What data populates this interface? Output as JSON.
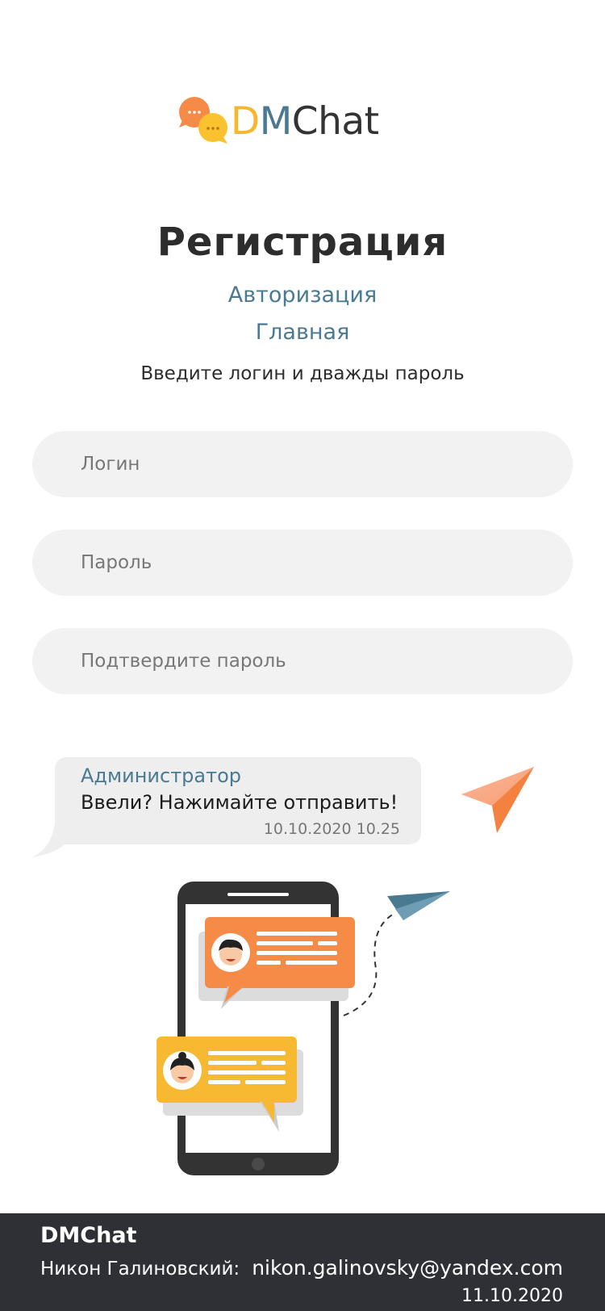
{
  "brand": {
    "d": "D",
    "m": "M",
    "rest": "Chat"
  },
  "page": {
    "title": "Регистрация",
    "auth_link": "Авторизация",
    "main_link": "Главная",
    "hint": "Введите логин и дважды пароль"
  },
  "form": {
    "login_placeholder": "Логин",
    "password_placeholder": "Пароль",
    "confirm_placeholder": "Подтвердите пароль"
  },
  "message": {
    "author": "Администратор",
    "text": "Ввели? Нажимайте отправить!",
    "time": "10.10.2020 10.25"
  },
  "footer": {
    "brand": "DMChat",
    "name": "Никон Галиновский:",
    "email": "nikon.galinovsky@yandex.com",
    "date": "11.10.2020"
  },
  "colors": {
    "accent_blue": "#4a7a92",
    "logo_yellow": "#f5b731",
    "orange": "#f58b46",
    "footer_bg": "#2e3035"
  },
  "icons": [
    "chat-bubbles-logo-icon",
    "paper-plane-send-icon",
    "phone-chat-illustration"
  ]
}
